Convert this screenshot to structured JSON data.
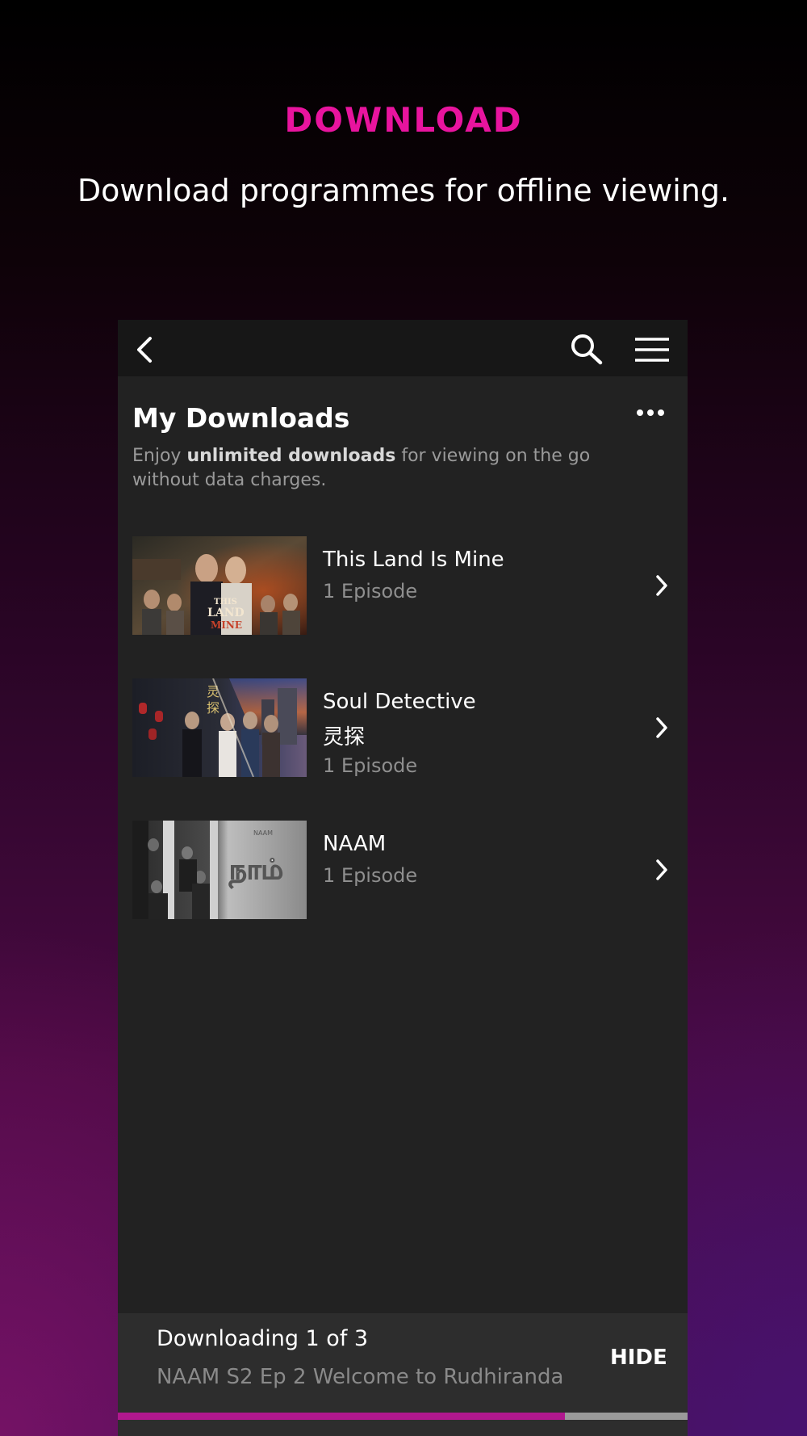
{
  "promo": {
    "title": "DOWNLOAD",
    "subtitle": "Download programmes for offline viewing."
  },
  "topbar": {
    "icons": [
      "chevron-left-icon",
      "search-icon",
      "hamburger-menu-icon"
    ]
  },
  "page": {
    "title": "My Downloads",
    "more_icon": "ellipsis-icon",
    "description_pre": "Enjoy ",
    "description_bold": "unlimited downloads",
    "description_post": " for viewing on the go without data charges."
  },
  "downloads": [
    {
      "title": "This Land Is Mine",
      "subtitle": "",
      "episodes": "1 Episode"
    },
    {
      "title": "Soul Detective",
      "subtitle": "灵探",
      "episodes": "1 Episode"
    },
    {
      "title": "NAAM",
      "subtitle": "",
      "episodes": "1 Episode"
    }
  ],
  "download_bar": {
    "status": "Downloading 1 of 3",
    "episode": "NAAM S2 Ep 2 Welcome to Rudhiranda",
    "hide_label": "HIDE",
    "progress": 0.785
  },
  "colors": {
    "accent": "#e8149e",
    "progress": "#b0188e"
  }
}
